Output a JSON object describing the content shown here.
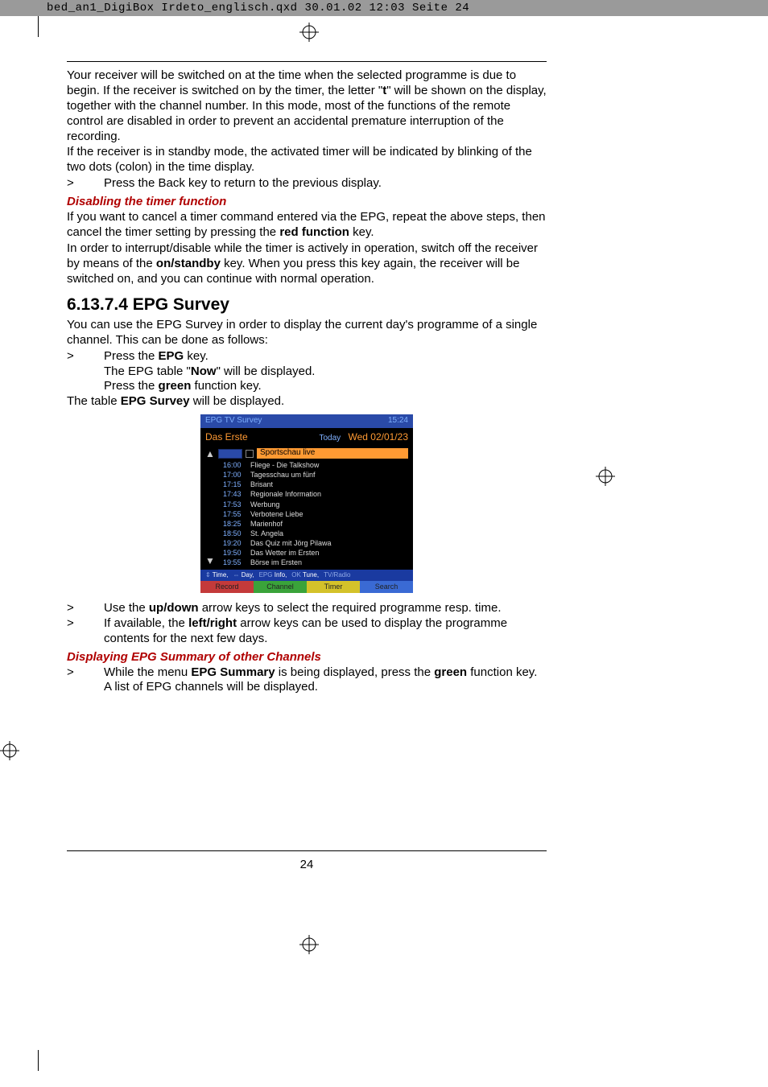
{
  "header": {
    "slug": "bed_an1_DigiBox Irdeto_englisch.qxd  30.01.02  12:03  Seite 24"
  },
  "body": {
    "p1": "Your receiver will be switched on at the time when the selected programme is due to begin. If the receiver is switched on by the timer, the letter \"",
    "p1b": "t",
    "p1c": "\" will be shown on the display, together with the channel number. In this mode, most of the functions of the remote control are disabled in order to prevent an accidental premature interruption of the recording.",
    "p2": "If the receiver is in standby mode, the activated timer will be indicated by blinking of the two dots (colon) in the time display.",
    "g1": "Press the Back key to return to the previous display.",
    "sec1": "Disabling the timer function",
    "p3a": "If you want to cancel a timer command entered via the EPG, repeat the above steps, then cancel the timer setting by pressing the ",
    "p3b": "red function",
    "p3c": " key.",
    "p4a": "In order to interrupt/disable while the timer is actively in operation, switch off the receiver by means of the ",
    "p4b": "on/standby",
    "p4c": " key. When you press this key again, the receiver will be switched on, and you can continue with normal operation.",
    "h2": "6.13.7.4 EPG Survey",
    "p5": "You can use the EPG Survey in order to display the current day's programme of a single channel. This can be done as follows:",
    "g2a": "Press the ",
    "g2b": "EPG",
    "g2c": " key.",
    "i1a": "The EPG table \"",
    "i1b": "Now",
    "i1c": "\" will be displayed.",
    "i2a": "Press the ",
    "i2b": "green",
    "i2c": " function key.",
    "p6a": "The table ",
    "p6b": "EPG Survey",
    "p6c": " will be displayed.",
    "g3a": "Use the ",
    "g3b": "up/down",
    "g3c": " arrow keys to select the required programme resp. time.",
    "g4a": "If available, the ",
    "g4b": "left/right",
    "g4c": " arrow keys can be used to display the programme contents for the next few days.",
    "sec2": "Displaying EPG Summary of other Channels",
    "g5a": "While the menu ",
    "g5b": "EPG Summary",
    "g5c": " is being displayed, press the ",
    "g5d": "green",
    "g5e": " function key.",
    "i3": "A list of EPG channels will be displayed."
  },
  "epg": {
    "title": "EPG TV Survey",
    "clock": "15:24",
    "channel": "Das Erste",
    "today": "Today",
    "date": "Wed 02/01/23",
    "highlight": "Sportschau live",
    "rows": [
      {
        "t": "16:00",
        "p": "Fliege - Die Talkshow"
      },
      {
        "t": "17:00",
        "p": "Tagesschau um fünf"
      },
      {
        "t": "17:15",
        "p": "Brisant"
      },
      {
        "t": "17:43",
        "p": "Regionale Information"
      },
      {
        "t": "17:53",
        "p": "Werbung"
      },
      {
        "t": "17:55",
        "p": "Verbotene Liebe"
      },
      {
        "t": "18:25",
        "p": "Marienhof"
      },
      {
        "t": "18:50",
        "p": "St. Angela"
      },
      {
        "t": "19:20",
        "p": "Das Quiz mit Jörg Pilawa"
      },
      {
        "t": "19:50",
        "p": "Das Wetter im Ersten"
      },
      {
        "t": "19:55",
        "p": "Börse im Ersten"
      }
    ],
    "hints": {
      "time": "Time,",
      "day": "Day,",
      "epg": "EPG",
      "info": "Info,",
      "ok": "OK",
      "tune": "Tune,",
      "tvr": "TV/Radio"
    },
    "btns": {
      "red": "Record",
      "green": "Channel",
      "yellow": "Timer",
      "blue": "Search"
    }
  },
  "gt": ">",
  "page": "24"
}
